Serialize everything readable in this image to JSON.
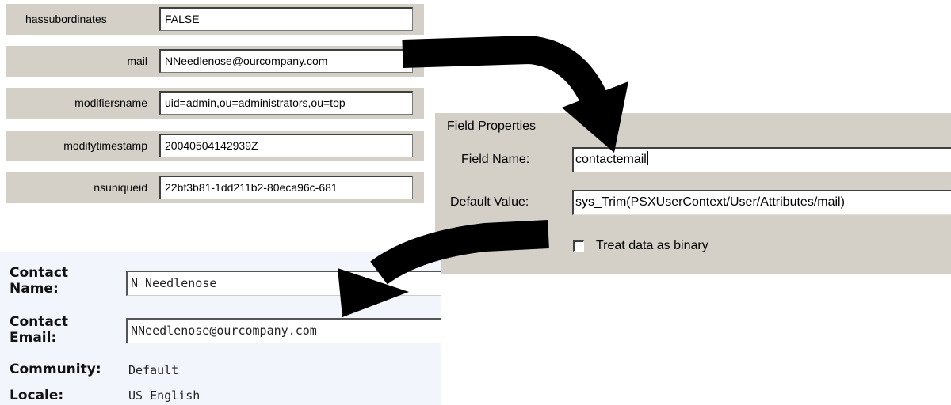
{
  "ldap": {
    "rows": [
      {
        "label": "hassubordinates",
        "value": "FALSE"
      },
      {
        "label": "mail",
        "value": "NNeedlenose@ourcompany.com"
      },
      {
        "label": "modifiersname",
        "value": "uid=admin,ou=administrators,ou=top"
      },
      {
        "label": "modifytimestamp",
        "value": "20040504142939Z"
      },
      {
        "label": "nsuniqueid",
        "value": "22bf3b81-1dd211b2-80eca96c-681"
      }
    ]
  },
  "field_properties": {
    "title": "Field Properties",
    "field_name_label": "Field Name:",
    "field_name_value": "contactemail",
    "default_value_label": "Default Value:",
    "default_value_value": "sys_Trim(PSXUserContext/User/Attributes/mail)",
    "binary_label": "Treat data as binary",
    "binary_checked": false
  },
  "contact": {
    "name_label": "Contact Name:",
    "name_value": "N Needlenose",
    "email_label": "Contact Email:",
    "email_value": "NNeedlenose@ourcompany.com",
    "community_label": "Community:",
    "community_value": "Default",
    "locale_label": "Locale:",
    "locale_value": "US English"
  }
}
